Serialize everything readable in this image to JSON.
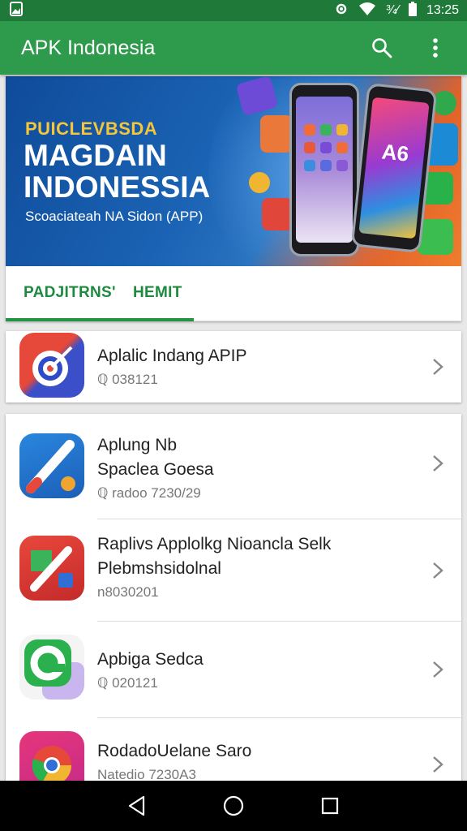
{
  "status_bar": {
    "battery_text": "¾⁄",
    "time": "13:25"
  },
  "app_bar": {
    "title": "APK Indonesia"
  },
  "banner": {
    "eyebrow": "PUICLEVBSDA",
    "title_line1": "MAGDAIN",
    "title_line2": "INDONESSIA",
    "subtitle": "Scoaciateah NA Sidon (APP)",
    "phone_badge": "A6"
  },
  "tabs": [
    {
      "label": "PADJITRNS'"
    },
    {
      "label": "HEMIT"
    }
  ],
  "featured": {
    "title": "Aplalic Indang APIP",
    "meta": "ℚ 038121"
  },
  "apps": [
    {
      "title_line1": "Aplung Nb",
      "title_line2": "Spaclea Goesa",
      "meta": "ℚ radoo 7230/29"
    },
    {
      "title_line1": "Raplivs Applolkg Nioancla Selk",
      "title_line2": "Plebmshsidolnal",
      "meta": "n8030201"
    },
    {
      "title_line1": "Apbiga Sedca",
      "title_line2": "",
      "meta": "ℚ 020121"
    },
    {
      "title_line1": "RodadoUelane Saro",
      "title_line2": "",
      "meta": "Natedio 7230A3"
    }
  ],
  "colors": {
    "status_bar": "#1f7a3a",
    "app_bar": "#2e9a4b",
    "accent": "#1f8a3f"
  }
}
